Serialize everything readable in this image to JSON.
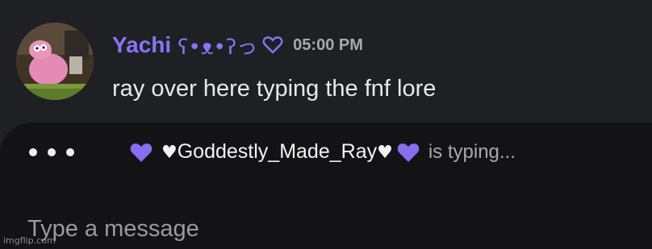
{
  "message": {
    "author": "Yachi",
    "author_decoration": "ʕ•ᴥ•ʔっ",
    "timestamp": "05:00 PM",
    "text": "ray over here typing the fnf lore",
    "colors": {
      "author": "#8a73f6",
      "text": "#e9e9ec",
      "timestamp": "#a9a9ad"
    }
  },
  "typing": {
    "user_name": "Goddestly_Made_Ray",
    "heart_glyph": "♥",
    "suffix": "is typing...",
    "heart_color": "#8a6cf0"
  },
  "composer": {
    "placeholder": "Type a message"
  },
  "watermark": "imgflip.com"
}
